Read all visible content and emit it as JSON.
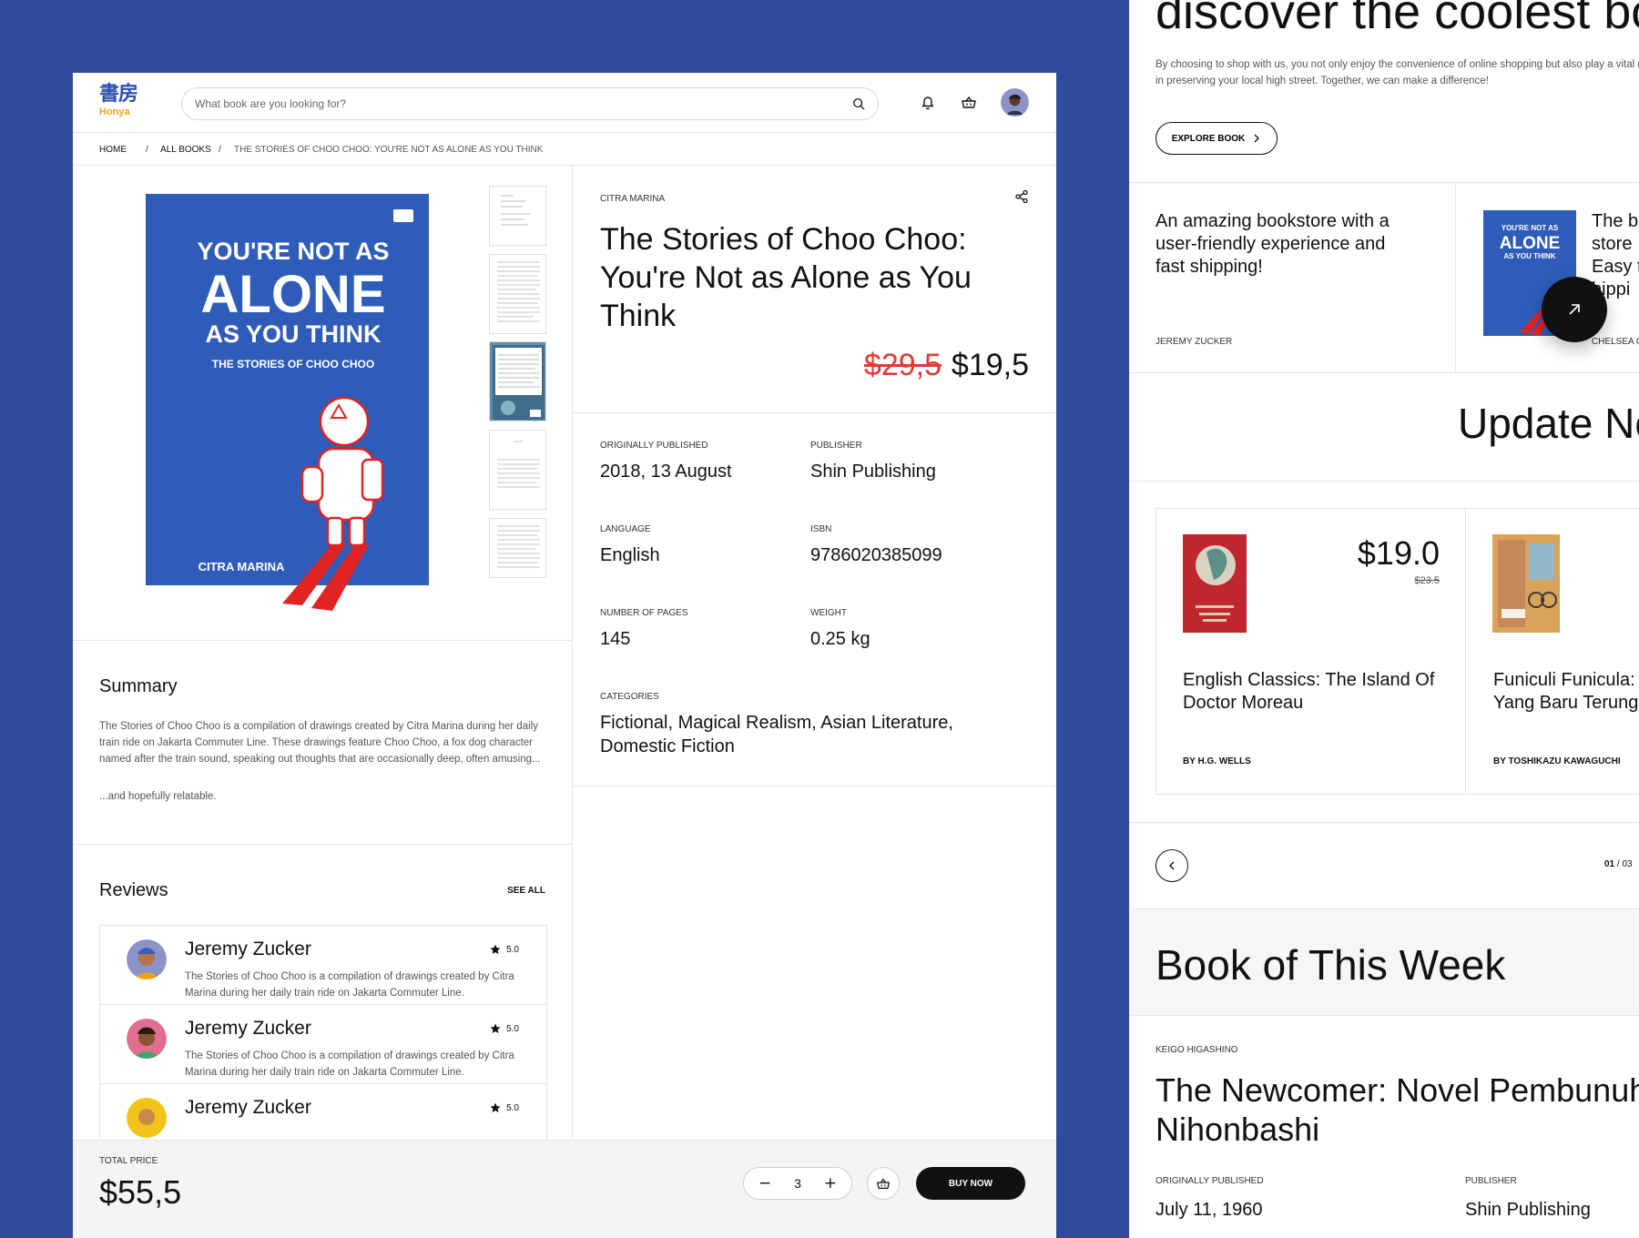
{
  "brand": {
    "kanji": "書房",
    "name": "Honya",
    "color": "#2f4fb0",
    "accent": "#f0a21c"
  },
  "search": {
    "placeholder": "What book are you looking for?"
  },
  "breadcrumb": {
    "items": [
      "HOME",
      "ALL BOOKS",
      "THE STORIES OF CHOO CHOO: YOU'RE NOT AS ALONE AS YOU THINK"
    ],
    "separator": "/"
  },
  "cover": {
    "line1": "YOU'RE NOT AS",
    "line2": "ALONE",
    "line3": "AS YOU THINK",
    "subtitle": "THE STORIES OF CHOO CHOO",
    "author": "CITRA MARINA",
    "color": "#2f5cb8"
  },
  "summary": {
    "heading": "Summary",
    "paragraph1": "The Stories of Choo Choo is a compilation of drawings created by Citra Marina during her daily train ride on Jakarta Commuter Line. These drawings feature Choo Choo, a fox dog character named after the train sound, speaking out thoughts that are occasionally deep, often amusing...",
    "paragraph2": "...and hopefully relatable."
  },
  "reviews": {
    "heading": "Reviews",
    "see_all": "SEE ALL",
    "items": [
      {
        "name": "Jeremy Zucker",
        "rating": "5.0",
        "text": "The Stories of Choo Choo is a compilation of drawings created by Citra Marina during her daily train ride on Jakarta Commuter Line."
      },
      {
        "name": "Jeremy Zucker",
        "rating": "5.0",
        "text": "The Stories of Choo Choo is a compilation of drawings created by Citra Marina during her daily train ride on Jakarta Commuter Line."
      },
      {
        "name": "Jeremy Zucker",
        "rating": "5.0",
        "text": ""
      }
    ]
  },
  "book": {
    "author": "CITRA MARINA",
    "title": "The Stories of Choo Choo: You're Not as Alone as You Think",
    "old_price": "$29,5",
    "price": "$19,5",
    "old_price_color": "#e53935",
    "meta": {
      "published_label": "ORIGINALLY PUBLISHED",
      "published": "2018, 13 August",
      "publisher_label": "PUBLISHER",
      "publisher": "Shin Publishing",
      "language_label": "LANGUAGE",
      "language": "English",
      "isbn_label": "ISBN",
      "isbn": "9786020385099",
      "pages_label": "NUMBER OF PAGES",
      "pages": "145",
      "weight_label": "WEIGHT",
      "weight": "0.25 kg",
      "categories_label": "CATEGORIES",
      "categories": "Fictional, Magical Realism, Asian Literature, Domestic Fiction"
    }
  },
  "checkout": {
    "total_label": "TOTAL PRICE",
    "total": "$55,5",
    "quantity": "3",
    "minus": "−",
    "plus": "+",
    "buy_label": "BUY NOW"
  },
  "side": {
    "hero_title": "discover the coolest bo",
    "hero_text": "By choosing to shop with us, you not only enjoy the convenience of online shopping but also play a vital role in preserving your local high street. Together, we can make a difference!",
    "explore_label": "EXPLORE BOOK",
    "testimonials": [
      {
        "quote": "An amazing bookstore with a user-friendly experience and fast shipping!",
        "author": "JEREMY ZUCKER"
      },
      {
        "quote": "The b\nstore\nEasy t\nhippi",
        "author": "CHELSEA C"
      }
    ],
    "update_title": "Update Ne",
    "cards": [
      {
        "title": "English Classics: The Island Of\nDoctor Moreau",
        "by": "BY H.G. WELLS",
        "price": "$19.0",
        "old_price": "$23.5",
        "cover_color": "#c0262e"
      },
      {
        "title": "Funiculi Funicula:\nYang Baru Terung",
        "by": "BY TOSHIKAZU KAWAGUCHI",
        "cover_color": "#d9a35a"
      }
    ],
    "pager": {
      "current": "01",
      "total": "/ 03"
    },
    "bow_title": "Book of This Week",
    "bow_author": "KEIGO HIGASHINO",
    "bow_book": "The Newcomer: Novel Pembunuh\nNihonbashi",
    "bow_published_label": "ORIGINALLY PUBLISHED",
    "bow_published": "July 11, 1960",
    "bow_publisher_label": "PUBLISHER",
    "bow_publisher": "Shin Publishing"
  },
  "icons": [
    "search-icon",
    "bell-icon",
    "basket-icon",
    "share-icon",
    "star-icon",
    "chevron-right-icon",
    "chevron-left-icon",
    "arrow-up-right-icon"
  ]
}
